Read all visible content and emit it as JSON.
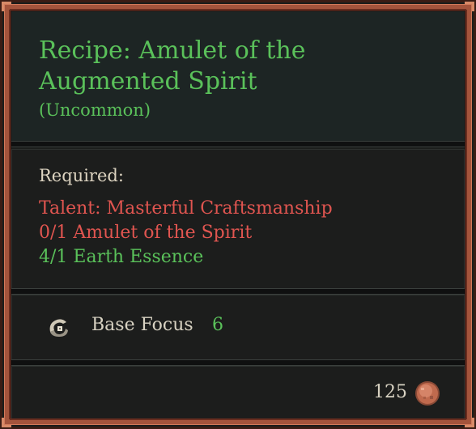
{
  "tooltip": {
    "title": "Recipe: Amulet of the Augmented Spirit",
    "rarity": "(Uncommon)",
    "rarity_color": "#5ac15a"
  },
  "requirements": {
    "label": "Required:",
    "items": [
      {
        "text": "Talent: Masterful Craftsmanship",
        "status": "unmet",
        "color": "#e05550"
      },
      {
        "text": "0/1 Amulet of the Spirit",
        "status": "unmet",
        "color": "#e05550"
      },
      {
        "text": "4/1 Earth Essence",
        "status": "met",
        "color": "#5ac15a"
      }
    ]
  },
  "stats": {
    "icon": "spiral-focus-icon",
    "label": "Base Focus",
    "value": "6"
  },
  "cost": {
    "value": "125",
    "icon": "copper-coin-icon"
  }
}
